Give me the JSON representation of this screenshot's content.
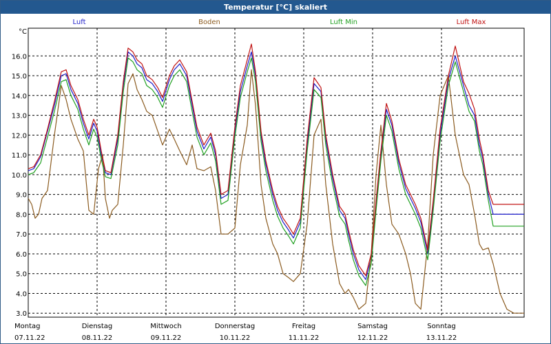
{
  "chart_data": {
    "type": "line",
    "title": "Temperatur [°C] skaliert",
    "ylabel": "°C",
    "ylim": [
      2.8,
      17.4
    ],
    "yticks": [
      "3.0",
      "4.0",
      "5.0",
      "6.0",
      "7.0",
      "8.0",
      "9.0",
      "10.0",
      "11.0",
      "12.0",
      "13.0",
      "14.0",
      "15.0",
      "16.0"
    ],
    "xlim": [
      0,
      7.2
    ],
    "days": [
      {
        "weekday": "Montag",
        "date": "07.11.22"
      },
      {
        "weekday": "Dienstag",
        "date": "08.11.22"
      },
      {
        "weekday": "Mittwoch",
        "date": "09.11.22"
      },
      {
        "weekday": "Donnerstag",
        "date": "10.11.22"
      },
      {
        "weekday": "Freitag",
        "date": "11.11.22"
      },
      {
        "weekday": "Samstag",
        "date": "12.11.22"
      },
      {
        "weekday": "Sonntag",
        "date": "13.11.22"
      }
    ],
    "grid": true,
    "series": [
      {
        "name": "Luft",
        "color": "#1c1cc8",
        "x": [
          0,
          0.08,
          0.18,
          0.28,
          0.38,
          0.48,
          0.55,
          0.62,
          0.72,
          0.8,
          0.88,
          0.95,
          1.0,
          1.06,
          1.12,
          1.2,
          1.3,
          1.38,
          1.45,
          1.52,
          1.58,
          1.65,
          1.72,
          1.8,
          1.88,
          1.95,
          2.05,
          2.12,
          2.2,
          2.3,
          2.38,
          2.45,
          2.55,
          2.65,
          2.72,
          2.8,
          2.9,
          3.0,
          3.08,
          3.18,
          3.24,
          3.3,
          3.38,
          3.45,
          3.55,
          3.62,
          3.7,
          3.78,
          3.85,
          3.95,
          4.05,
          4.15,
          4.25,
          4.32,
          4.42,
          4.52,
          4.6,
          4.65,
          4.72,
          4.8,
          4.9,
          4.98,
          5.05,
          5.12,
          5.2,
          5.28,
          5.38,
          5.48,
          5.55,
          5.62,
          5.7,
          5.8,
          5.88,
          5.98,
          6.1,
          6.2,
          6.32,
          6.4,
          6.48,
          6.55,
          6.6,
          6.68,
          6.75,
          6.85,
          6.95,
          7.05,
          7.12,
          7.2
        ],
        "y": [
          10.2,
          10.3,
          10.9,
          12.2,
          13.5,
          15.0,
          15.1,
          14.3,
          13.6,
          12.6,
          11.8,
          12.6,
          12.2,
          11.0,
          10.1,
          10.0,
          11.8,
          14.5,
          16.2,
          16.0,
          15.6,
          15.4,
          14.8,
          14.6,
          14.2,
          13.7,
          14.8,
          15.3,
          15.6,
          15.0,
          13.5,
          12.2,
          11.3,
          11.9,
          11.0,
          8.8,
          9.0,
          12.2,
          14.2,
          15.5,
          16.2,
          15.0,
          12.0,
          10.5,
          9.0,
          8.2,
          7.6,
          7.2,
          6.8,
          7.6,
          11.5,
          14.6,
          14.2,
          11.8,
          9.8,
          8.2,
          7.8,
          7.0,
          6.0,
          5.2,
          4.7,
          5.8,
          8.5,
          11.0,
          13.3,
          12.5,
          10.6,
          9.3,
          8.8,
          8.3,
          7.6,
          6.0,
          8.5,
          12.0,
          14.8,
          16.0,
          14.5,
          13.5,
          13.0,
          11.5,
          10.8,
          9.0,
          8.0,
          8.0,
          8.0,
          8.0,
          8.0,
          8.0
        ]
      },
      {
        "name": "Boden",
        "color": "#8a5a1e",
        "x": [
          0,
          0.05,
          0.1,
          0.15,
          0.2,
          0.28,
          0.38,
          0.48,
          0.55,
          0.62,
          0.72,
          0.8,
          0.88,
          0.95,
          1.02,
          1.08,
          1.12,
          1.18,
          1.22,
          1.3,
          1.38,
          1.45,
          1.52,
          1.58,
          1.65,
          1.72,
          1.8,
          1.88,
          1.95,
          2.05,
          2.12,
          2.2,
          2.3,
          2.38,
          2.45,
          2.55,
          2.65,
          2.72,
          2.8,
          2.9,
          3.0,
          3.08,
          3.18,
          3.24,
          3.3,
          3.38,
          3.45,
          3.55,
          3.62,
          3.7,
          3.78,
          3.85,
          3.95,
          4.05,
          4.15,
          4.25,
          4.32,
          4.42,
          4.52,
          4.6,
          4.65,
          4.72,
          4.8,
          4.9,
          4.98,
          5.05,
          5.12,
          5.2,
          5.28,
          5.38,
          5.48,
          5.55,
          5.62,
          5.7,
          5.8,
          5.88,
          5.98,
          6.1,
          6.2,
          6.32,
          6.4,
          6.48,
          6.55,
          6.6,
          6.68,
          6.75,
          6.85,
          6.95,
          7.05,
          7.12,
          7.2
        ],
        "y": [
          8.8,
          8.5,
          7.8,
          8.0,
          8.8,
          9.2,
          12.0,
          14.5,
          13.8,
          12.8,
          11.8,
          11.2,
          8.2,
          8.0,
          10.3,
          11.0,
          8.8,
          7.8,
          8.2,
          8.5,
          11.5,
          14.6,
          15.1,
          14.3,
          13.8,
          13.2,
          13.0,
          12.2,
          11.5,
          12.3,
          11.8,
          11.2,
          10.5,
          11.5,
          10.3,
          10.2,
          10.4,
          9.2,
          7.0,
          7.0,
          7.3,
          10.5,
          12.5,
          15.3,
          13.5,
          9.5,
          7.8,
          6.5,
          6.0,
          5.0,
          4.8,
          4.6,
          5.0,
          7.5,
          12.0,
          12.8,
          9.5,
          6.5,
          4.5,
          4.0,
          4.2,
          3.8,
          3.2,
          3.5,
          6.0,
          10.0,
          12.5,
          9.5,
          7.5,
          7.0,
          6.0,
          5.0,
          3.5,
          3.2,
          6.5,
          11.0,
          14.0,
          15.0,
          12.0,
          10.0,
          9.5,
          8.0,
          6.5,
          6.2,
          6.3,
          5.5,
          4.0,
          3.2,
          3.0,
          3.0,
          3.0
        ]
      },
      {
        "name": "Luft Min",
        "color": "#20a020",
        "x": [
          0,
          0.08,
          0.18,
          0.28,
          0.38,
          0.48,
          0.55,
          0.62,
          0.72,
          0.8,
          0.88,
          0.95,
          1.0,
          1.06,
          1.12,
          1.2,
          1.3,
          1.38,
          1.45,
          1.52,
          1.58,
          1.65,
          1.72,
          1.8,
          1.88,
          1.95,
          2.05,
          2.12,
          2.2,
          2.3,
          2.38,
          2.45,
          2.55,
          2.65,
          2.72,
          2.8,
          2.9,
          3.0,
          3.08,
          3.18,
          3.24,
          3.3,
          3.38,
          3.45,
          3.55,
          3.62,
          3.7,
          3.78,
          3.85,
          3.95,
          4.05,
          4.15,
          4.25,
          4.32,
          4.42,
          4.52,
          4.6,
          4.65,
          4.72,
          4.8,
          4.9,
          4.98,
          5.05,
          5.12,
          5.2,
          5.28,
          5.38,
          5.48,
          5.55,
          5.62,
          5.7,
          5.8,
          5.88,
          5.98,
          6.1,
          6.2,
          6.32,
          6.4,
          6.48,
          6.55,
          6.6,
          6.68,
          6.75,
          6.85,
          6.95,
          7.05,
          7.12,
          7.2
        ],
        "y": [
          10.0,
          10.1,
          10.6,
          11.9,
          13.2,
          14.7,
          14.8,
          14.0,
          13.3,
          12.3,
          11.5,
          12.3,
          11.9,
          10.8,
          9.9,
          9.8,
          11.5,
          14.2,
          15.9,
          15.7,
          15.3,
          15.1,
          14.5,
          14.3,
          13.9,
          13.4,
          14.5,
          15.0,
          15.3,
          14.7,
          13.2,
          11.9,
          11.0,
          11.6,
          10.7,
          8.5,
          8.7,
          11.9,
          13.9,
          15.2,
          15.9,
          14.7,
          11.7,
          10.2,
          8.7,
          7.9,
          7.3,
          6.9,
          6.5,
          7.3,
          11.2,
          14.3,
          13.9,
          11.5,
          9.5,
          7.9,
          7.5,
          6.7,
          5.7,
          4.9,
          4.4,
          5.5,
          8.2,
          10.7,
          13.0,
          12.2,
          10.3,
          9.0,
          8.5,
          8.0,
          7.3,
          5.7,
          8.2,
          11.7,
          14.5,
          15.7,
          14.2,
          13.2,
          12.7,
          11.2,
          10.5,
          8.7,
          7.4,
          7.4,
          7.4,
          7.4,
          7.4,
          7.4
        ]
      },
      {
        "name": "Luft Max",
        "color": "#c01010",
        "x": [
          0,
          0.08,
          0.18,
          0.28,
          0.38,
          0.48,
          0.55,
          0.62,
          0.72,
          0.8,
          0.88,
          0.95,
          1.0,
          1.06,
          1.12,
          1.2,
          1.3,
          1.38,
          1.45,
          1.52,
          1.58,
          1.65,
          1.72,
          1.8,
          1.88,
          1.95,
          2.05,
          2.12,
          2.2,
          2.3,
          2.38,
          2.45,
          2.55,
          2.65,
          2.72,
          2.8,
          2.9,
          3.0,
          3.08,
          3.18,
          3.24,
          3.3,
          3.38,
          3.45,
          3.55,
          3.62,
          3.7,
          3.78,
          3.85,
          3.95,
          4.05,
          4.15,
          4.25,
          4.32,
          4.42,
          4.52,
          4.6,
          4.65,
          4.72,
          4.8,
          4.9,
          4.98,
          5.05,
          5.12,
          5.2,
          5.28,
          5.38,
          5.48,
          5.55,
          5.62,
          5.7,
          5.8,
          5.88,
          5.98,
          6.1,
          6.2,
          6.32,
          6.4,
          6.48,
          6.55,
          6.6,
          6.68,
          6.75,
          6.85,
          6.95,
          7.05,
          7.12,
          7.2
        ],
        "y": [
          10.3,
          10.4,
          11.0,
          12.3,
          13.7,
          15.2,
          15.3,
          14.5,
          13.8,
          12.8,
          12.0,
          12.8,
          12.4,
          11.2,
          10.2,
          10.1,
          12.0,
          14.7,
          16.4,
          16.2,
          15.8,
          15.6,
          15.0,
          14.8,
          14.4,
          13.9,
          15.0,
          15.5,
          15.8,
          15.2,
          13.7,
          12.4,
          11.5,
          12.1,
          11.2,
          9.0,
          9.2,
          12.4,
          14.5,
          15.8,
          16.6,
          15.2,
          12.2,
          10.7,
          9.2,
          8.4,
          7.8,
          7.4,
          7.0,
          7.8,
          11.8,
          14.9,
          14.4,
          12.0,
          10.0,
          8.4,
          8.0,
          7.2,
          6.2,
          5.4,
          4.9,
          6.0,
          8.7,
          11.2,
          13.6,
          12.7,
          10.8,
          9.5,
          9.0,
          8.5,
          7.8,
          6.2,
          8.7,
          12.3,
          15.0,
          16.5,
          14.7,
          14.1,
          13.3,
          11.8,
          11.0,
          9.2,
          8.5,
          8.5,
          8.5,
          8.5,
          8.5,
          8.5
        ]
      }
    ]
  }
}
